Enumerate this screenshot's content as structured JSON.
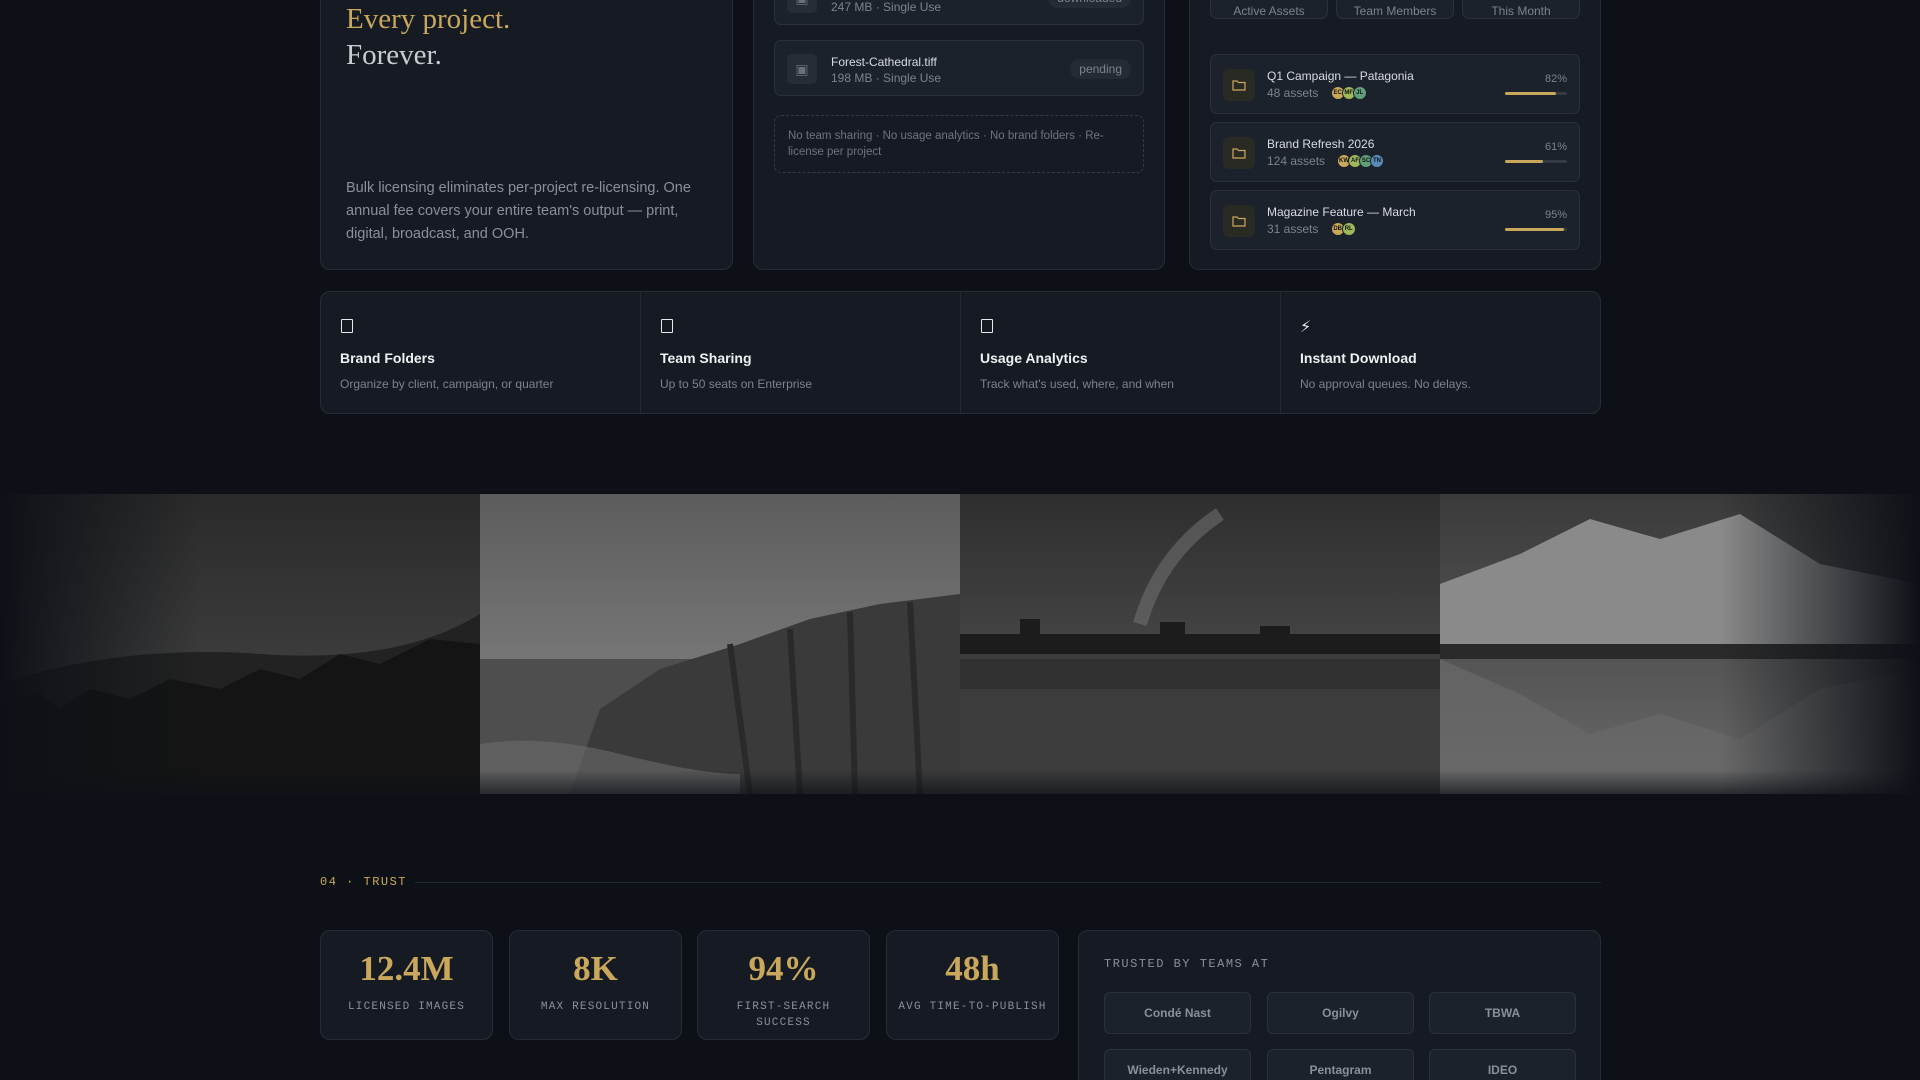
{
  "hero": {
    "line1": "Every project.",
    "line2": "Forever.",
    "description": "Bulk licensing eliminates per-project re-licensing. One annual fee covers your entire team's output — print, digital, broadcast, and OOH."
  },
  "files": {
    "items": [
      {
        "name": "",
        "meta": "247 MB · Single Use",
        "status": "downloaded"
      },
      {
        "name": "Forest-Cathedral.tiff",
        "meta": "198 MB · Single Use",
        "status": "pending"
      }
    ],
    "note": "No team sharing · No usage analytics · No brand folders · Re-license per project"
  },
  "stats": [
    {
      "label": "Active Assets"
    },
    {
      "label": "Team Members"
    },
    {
      "label": "This Month"
    }
  ],
  "projects": [
    {
      "name": "Q1 Campaign — Patagonia",
      "meta": "48 assets",
      "pct_label": "82%",
      "progress": 0.82,
      "avatars": [
        {
          "t": "EC",
          "c": "#c9a85c"
        },
        {
          "t": "MF",
          "c": "#9fb85a"
        },
        {
          "t": "JL",
          "c": "#5fa07a"
        }
      ]
    },
    {
      "name": "Brand Refresh 2026",
      "meta": "124 assets",
      "pct_label": "61%",
      "progress": 0.61,
      "avatars": [
        {
          "t": "KW",
          "c": "#c9a85c"
        },
        {
          "t": "AF",
          "c": "#9fb85a"
        },
        {
          "t": "SC",
          "c": "#5fa07a"
        },
        {
          "t": "TN",
          "c": "#5a8ab8"
        }
      ]
    },
    {
      "name": "Magazine Feature — March",
      "meta": "31 assets",
      "pct_label": "95%",
      "progress": 0.95,
      "avatars": [
        {
          "t": "DB",
          "c": "#c9a85c"
        },
        {
          "t": "RL",
          "c": "#9fb85a"
        }
      ]
    }
  ],
  "features": [
    {
      "icon": "folder-icon",
      "title": "Brand Folders",
      "desc": "Organize by client, campaign, or quarter"
    },
    {
      "icon": "users-icon",
      "title": "Team Sharing",
      "desc": "Up to 50 seats on Enterprise"
    },
    {
      "icon": "chart-icon",
      "title": "Usage Analytics",
      "desc": "Track what's used, where, and when"
    },
    {
      "icon": "lightning-icon",
      "glyph": "⚡",
      "title": "Instant Download",
      "desc": "No approval queues. No delays."
    }
  ],
  "trust": {
    "section_label": "04 · TRUST",
    "metrics": [
      {
        "value": "12.4M",
        "caption": "LICENSED IMAGES"
      },
      {
        "value": "8K",
        "caption": "MAX RESOLUTION"
      },
      {
        "value": "94%",
        "caption": "FIRST-SEARCH SUCCESS"
      },
      {
        "value": "48h",
        "caption": "AVG TIME-TO-PUBLISH"
      }
    ],
    "trusted_title": "TRUSTED BY TEAMS AT",
    "logos": [
      "Condé Nast",
      "Ogilvy",
      "TBWA",
      "Wieden+Kennedy",
      "Pentagram",
      "IDEO"
    ]
  },
  "colors": {
    "accent": "#c9a85c",
    "background": "#0d1117",
    "card": "#161b23"
  }
}
